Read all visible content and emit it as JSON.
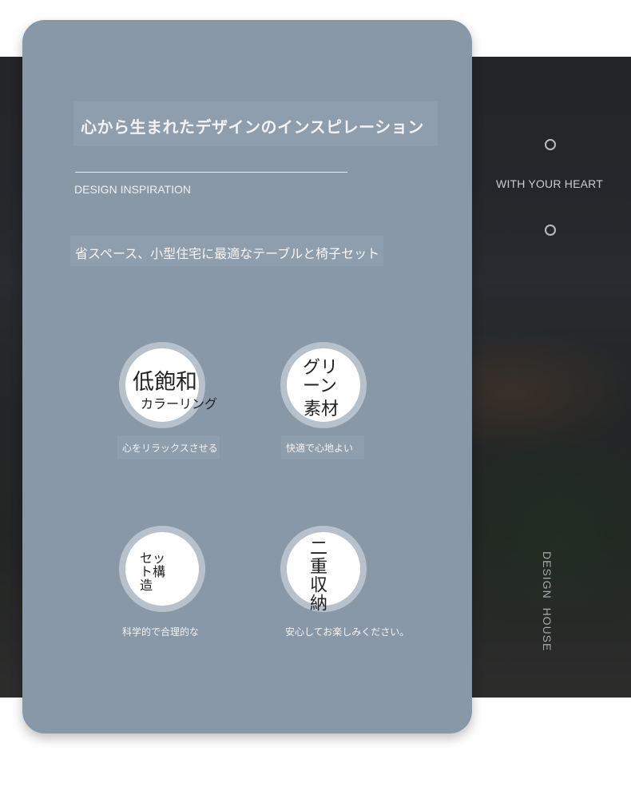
{
  "background": {
    "tagline": "WITH YOUR HEART",
    "vertical_label": "DESIGN  HOUSE"
  },
  "card": {
    "title": "心から生まれたデザインのインスピレーション",
    "subtitle": "DESIGN INSPIRATION",
    "description": "省スペース、小型住宅に最適なテーブルと椅子セット"
  },
  "features": [
    {
      "main": "低飽和",
      "sub": "カラーリング",
      "caption": "心をリラックスさせる"
    },
    {
      "main": "グリーン",
      "sub": "素材",
      "caption": "快適で心地よい"
    },
    {
      "main": "セット構造",
      "caption": "科学的で合理的な"
    },
    {
      "main": "二重収納",
      "caption": "安心してお楽しみください。"
    }
  ],
  "colors": {
    "card": "#8898a7",
    "ring": "#b7c1cb",
    "text_light": "#f1f3f6",
    "text_dark": "#222222"
  }
}
